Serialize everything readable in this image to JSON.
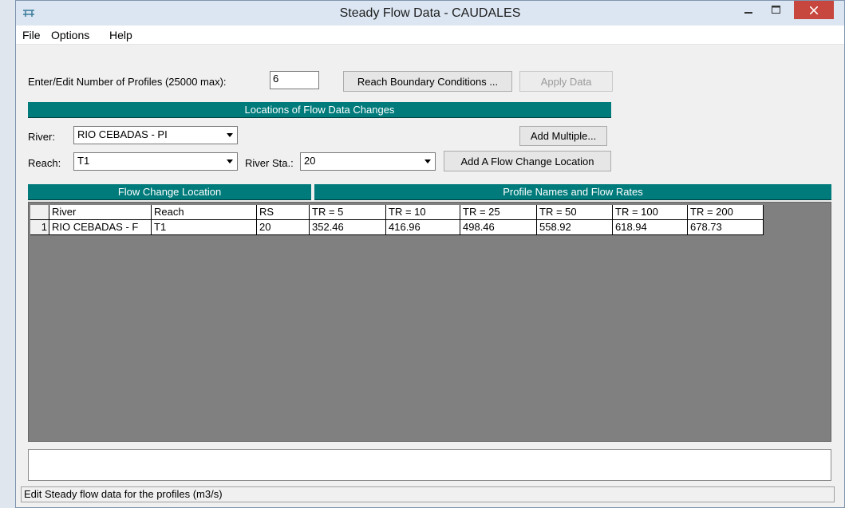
{
  "window": {
    "title": "Steady Flow Data - CAUDALES"
  },
  "menu": {
    "file": "File",
    "options": "Options",
    "help": "Help"
  },
  "profiles": {
    "label": "Enter/Edit Number of Profiles (25000 max):",
    "value": "6",
    "reach_bc_button": "Reach Boundary Conditions ...",
    "apply_button": "Apply Data"
  },
  "locations": {
    "header": "Locations of Flow Data Changes",
    "river_label": "River:",
    "river_value": "RIO CEBADAS - PI",
    "add_multiple_button": "Add Multiple...",
    "reach_label": "Reach:",
    "reach_value": "T1",
    "river_sta_label": "River Sta.:",
    "river_sta_value": "20",
    "add_location_button": "Add A Flow Change Location"
  },
  "table": {
    "left_header": "Flow Change Location",
    "right_header": "Profile Names and Flow Rates",
    "columns": [
      "River",
      "Reach",
      "RS",
      "TR = 5",
      "TR = 10",
      "TR = 25",
      "TR = 50",
      "TR = 100",
      "TR = 200"
    ],
    "rows": [
      {
        "num": "1",
        "cells": [
          "RIO CEBADAS - F",
          "T1",
          "20",
          "352.46",
          "416.96",
          "498.46",
          "558.92",
          "618.94",
          "678.73"
        ]
      }
    ]
  },
  "status": {
    "text": "Edit Steady flow data for the profiles (m3/s)"
  },
  "colors": {
    "header_teal": "#007b7b",
    "grid_bg": "#808080",
    "close_red": "#c7463d"
  }
}
